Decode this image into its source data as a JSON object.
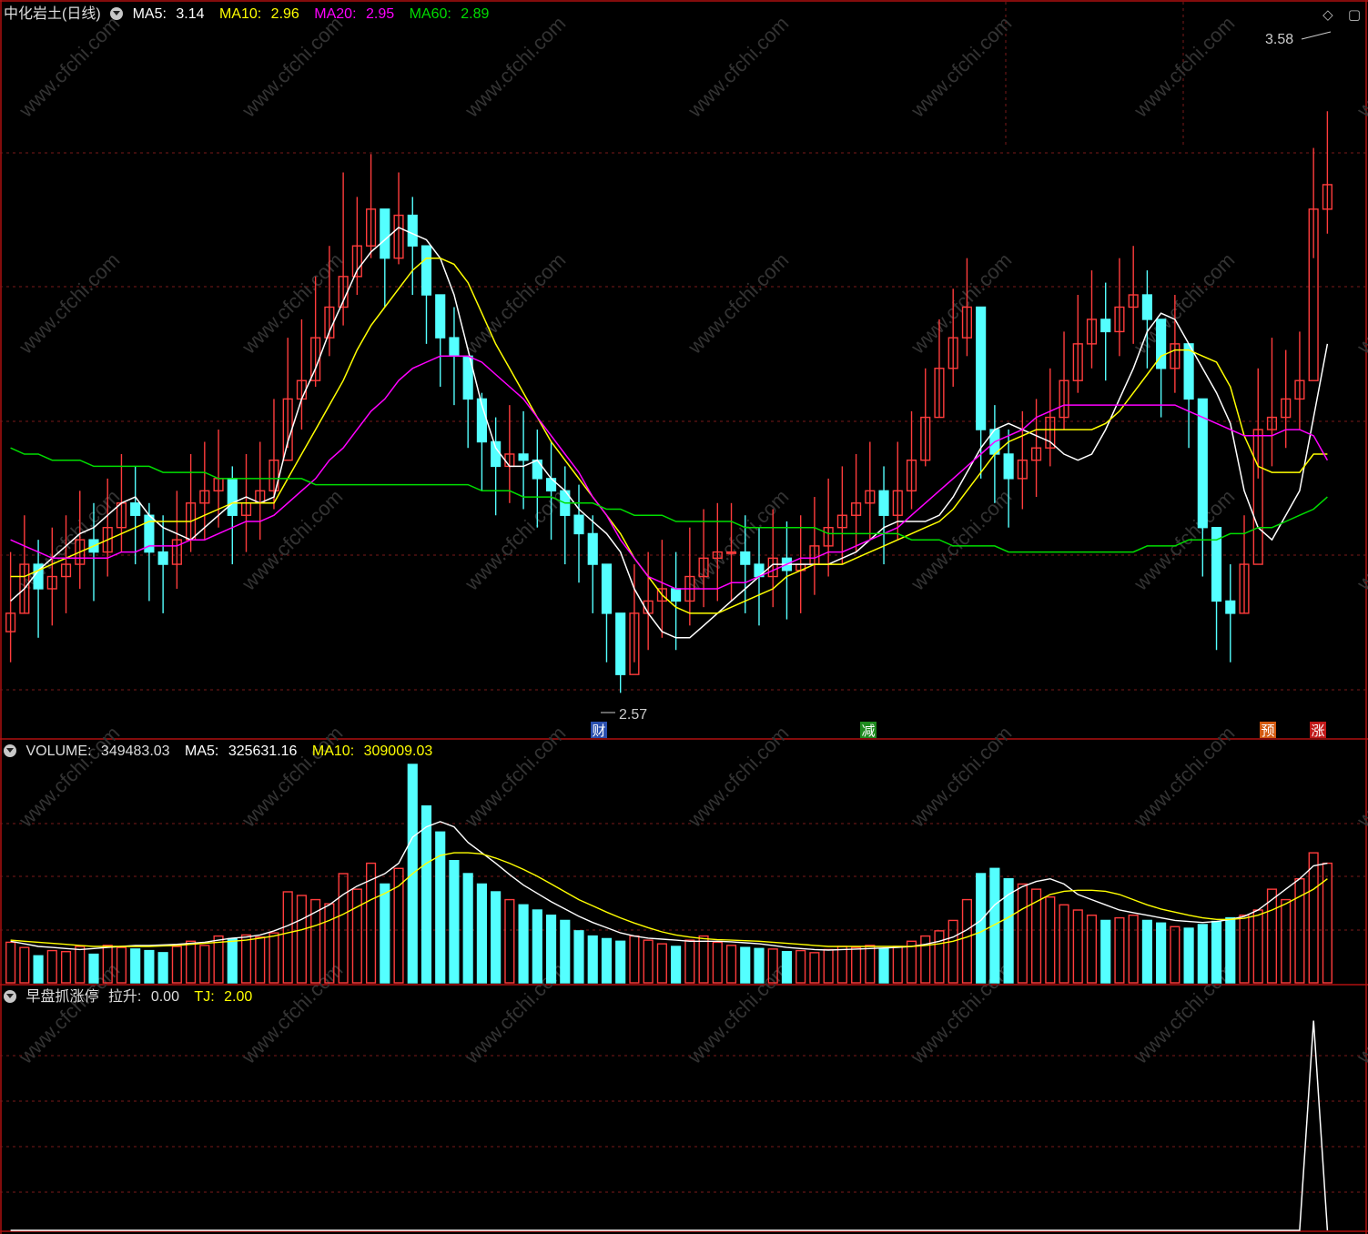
{
  "panel_price": {
    "stock_name": "中化岩土(日线)",
    "ma5_label": "MA5:",
    "ma5_value": "3.14",
    "ma10_label": "MA10:",
    "ma10_value": "2.96",
    "ma20_label": "MA20:",
    "ma20_value": "2.95",
    "ma60_label": "MA60:",
    "ma60_value": "2.89",
    "high_marker": "3.58",
    "low_marker": "2.57",
    "event_labels": [
      "财",
      "减",
      "预",
      "涨"
    ]
  },
  "panel_volume": {
    "volume_label": "VOLUME:",
    "volume_value": "349483.03",
    "ma5_label": "MA5:",
    "ma5_value": "325631.16",
    "ma10_label": "MA10:",
    "ma10_value": "309009.03"
  },
  "panel_indicator": {
    "name": "早盘抓涨停",
    "lift_label": "拉升:",
    "lift_value": "0.00",
    "tj_label": "TJ:",
    "tj_value": "2.00"
  },
  "icons": [
    "diamond-icon",
    "window-icon",
    "dropdown-icon"
  ],
  "watermark": "www.cfchi.com",
  "colors": {
    "up": "#ff3c3c",
    "down": "#54ffff",
    "ma5": "#ffffff",
    "ma10": "#ffff00",
    "ma20": "#ff00ff",
    "ma60": "#00dd00",
    "grid": "#7a1a1a",
    "border": "#b01010"
  },
  "chart_data": [
    {
      "type": "candlestick",
      "title": "中化岩土(日线)",
      "ylim": [
        2.52,
        3.66
      ],
      "series": [
        {
          "name": "MA5",
          "values": [
            2.72,
            2.74,
            2.77,
            2.79,
            2.81,
            2.83,
            2.84,
            2.86,
            2.88,
            2.89,
            2.86,
            2.84,
            2.83,
            2.82,
            2.84,
            2.86,
            2.88,
            2.89,
            2.88,
            2.89,
            2.98,
            3.05,
            3.1,
            3.16,
            3.21,
            3.26,
            3.29,
            3.31,
            3.33,
            3.32,
            3.31,
            3.28,
            3.22,
            3.13,
            3.04,
            2.97,
            2.94,
            2.94,
            2.95,
            2.92,
            2.9,
            2.87,
            2.85,
            2.83,
            2.8,
            2.74,
            2.7,
            2.67,
            2.66,
            2.66,
            2.68,
            2.7,
            2.72,
            2.74,
            2.76,
            2.78,
            2.78,
            2.78,
            2.78,
            2.78,
            2.79,
            2.8,
            2.82,
            2.84,
            2.85,
            2.85,
            2.85,
            2.86,
            2.89,
            2.93,
            2.97,
            3.0,
            3.01,
            3.0,
            2.99,
            2.98,
            2.96,
            2.95,
            2.96,
            3.0,
            3.05,
            3.1,
            3.16,
            3.19,
            3.18,
            3.14,
            3.1,
            3.06,
            3.01,
            2.9,
            2.84,
            2.82,
            2.86,
            2.9,
            3.02,
            3.14
          ]
        },
        {
          "name": "MA10",
          "values": [
            2.76,
            2.76,
            2.77,
            2.78,
            2.79,
            2.8,
            2.81,
            2.82,
            2.83,
            2.84,
            2.85,
            2.85,
            2.85,
            2.85,
            2.86,
            2.87,
            2.88,
            2.88,
            2.88,
            2.88,
            2.92,
            2.96,
            3.0,
            3.04,
            3.08,
            3.13,
            3.17,
            3.2,
            3.23,
            3.26,
            3.28,
            3.28,
            3.27,
            3.24,
            3.19,
            3.14,
            3.1,
            3.06,
            3.02,
            2.98,
            2.95,
            2.92,
            2.89,
            2.86,
            2.83,
            2.79,
            2.76,
            2.73,
            2.71,
            2.7,
            2.7,
            2.7,
            2.71,
            2.72,
            2.73,
            2.74,
            2.76,
            2.77,
            2.78,
            2.78,
            2.78,
            2.79,
            2.8,
            2.81,
            2.82,
            2.83,
            2.84,
            2.85,
            2.87,
            2.9,
            2.93,
            2.96,
            2.98,
            2.99,
            3.0,
            3.0,
            3.0,
            3.0,
            3.0,
            3.01,
            3.03,
            3.06,
            3.09,
            3.12,
            3.13,
            3.13,
            3.12,
            3.11,
            3.07,
            2.99,
            2.94,
            2.93,
            2.93,
            2.93,
            2.96,
            2.96
          ]
        },
        {
          "name": "MA20",
          "values": [
            2.82,
            2.81,
            2.8,
            2.79,
            2.79,
            2.79,
            2.79,
            2.79,
            2.8,
            2.8,
            2.81,
            2.81,
            2.81,
            2.82,
            2.82,
            2.83,
            2.84,
            2.85,
            2.85,
            2.86,
            2.88,
            2.9,
            2.92,
            2.95,
            2.97,
            3.0,
            3.03,
            3.05,
            3.08,
            3.1,
            3.11,
            3.12,
            3.12,
            3.12,
            3.11,
            3.09,
            3.07,
            3.05,
            3.02,
            2.99,
            2.96,
            2.93,
            2.89,
            2.86,
            2.82,
            2.79,
            2.76,
            2.75,
            2.74,
            2.74,
            2.74,
            2.74,
            2.75,
            2.75,
            2.76,
            2.77,
            2.78,
            2.79,
            2.79,
            2.8,
            2.8,
            2.81,
            2.82,
            2.83,
            2.84,
            2.86,
            2.88,
            2.9,
            2.92,
            2.94,
            2.96,
            2.98,
            2.99,
            3.0,
            3.02,
            3.03,
            3.04,
            3.04,
            3.04,
            3.04,
            3.04,
            3.04,
            3.04,
            3.04,
            3.04,
            3.03,
            3.02,
            3.01,
            3.0,
            2.99,
            2.99,
            2.99,
            3.0,
            3.0,
            2.99,
            2.95
          ]
        },
        {
          "name": "MA60",
          "values": [
            2.97,
            2.96,
            2.96,
            2.95,
            2.95,
            2.95,
            2.94,
            2.94,
            2.94,
            2.94,
            2.94,
            2.93,
            2.93,
            2.93,
            2.93,
            2.92,
            2.92,
            2.92,
            2.92,
            2.92,
            2.92,
            2.92,
            2.91,
            2.91,
            2.91,
            2.91,
            2.91,
            2.91,
            2.91,
            2.91,
            2.91,
            2.91,
            2.91,
            2.91,
            2.9,
            2.9,
            2.9,
            2.89,
            2.89,
            2.89,
            2.88,
            2.88,
            2.88,
            2.87,
            2.87,
            2.86,
            2.86,
            2.86,
            2.85,
            2.85,
            2.85,
            2.85,
            2.85,
            2.84,
            2.84,
            2.84,
            2.84,
            2.84,
            2.84,
            2.83,
            2.83,
            2.83,
            2.83,
            2.83,
            2.83,
            2.82,
            2.82,
            2.82,
            2.81,
            2.81,
            2.81,
            2.81,
            2.8,
            2.8,
            2.8,
            2.8,
            2.8,
            2.8,
            2.8,
            2.8,
            2.8,
            2.8,
            2.81,
            2.81,
            2.81,
            2.82,
            2.82,
            2.82,
            2.83,
            2.83,
            2.84,
            2.84,
            2.85,
            2.86,
            2.87,
            2.89
          ]
        }
      ],
      "candles_close": [
        2.7,
        2.78,
        2.74,
        2.76,
        2.78,
        2.82,
        2.8,
        2.84,
        2.88,
        2.86,
        2.8,
        2.78,
        2.82,
        2.88,
        2.9,
        2.92,
        2.86,
        2.88,
        2.9,
        2.95,
        3.05,
        3.08,
        3.15,
        3.2,
        3.25,
        3.3,
        3.36,
        3.28,
        3.35,
        3.3,
        3.22,
        3.15,
        3.12,
        3.05,
        2.98,
        2.94,
        2.96,
        2.95,
        2.92,
        2.9,
        2.86,
        2.83,
        2.78,
        2.7,
        2.6,
        2.7,
        2.72,
        2.74,
        2.72,
        2.76,
        2.79,
        2.8,
        2.8,
        2.78,
        2.76,
        2.79,
        2.77,
        2.78,
        2.81,
        2.84,
        2.86,
        2.88,
        2.9,
        2.86,
        2.9,
        2.95,
        3.02,
        3.1,
        3.15,
        3.2,
        3.0,
        2.96,
        2.92,
        2.95,
        2.97,
        3.02,
        3.08,
        3.14,
        3.18,
        3.16,
        3.2,
        3.22,
        3.18,
        3.1,
        3.14,
        3.05,
        2.84,
        2.72,
        2.7,
        2.78,
        3.0,
        3.02,
        3.05,
        3.08,
        3.36,
        3.4
      ],
      "candles_high": [
        2.8,
        2.86,
        2.82,
        2.84,
        2.86,
        2.9,
        2.88,
        2.92,
        2.96,
        2.94,
        2.88,
        2.86,
        2.9,
        2.96,
        2.98,
        3.0,
        2.94,
        2.96,
        2.98,
        3.05,
        3.15,
        3.18,
        3.25,
        3.3,
        3.42,
        3.38,
        3.45,
        3.36,
        3.42,
        3.38,
        3.3,
        3.22,
        3.2,
        3.12,
        3.06,
        3.02,
        3.04,
        3.03,
        3.0,
        2.98,
        2.94,
        2.91,
        2.86,
        2.78,
        2.7,
        2.78,
        2.8,
        2.82,
        2.8,
        2.84,
        2.87,
        2.88,
        2.88,
        2.86,
        2.84,
        2.87,
        2.85,
        2.86,
        2.89,
        2.92,
        2.94,
        2.96,
        2.98,
        2.94,
        2.98,
        3.03,
        3.1,
        3.18,
        3.23,
        3.28,
        3.08,
        3.04,
        3.0,
        3.03,
        3.05,
        3.1,
        3.16,
        3.22,
        3.26,
        3.24,
        3.28,
        3.3,
        3.26,
        3.18,
        3.22,
        3.13,
        2.92,
        2.8,
        2.78,
        2.86,
        3.1,
        3.15,
        3.13,
        3.16,
        3.46,
        3.52
      ],
      "candles_low": [
        2.62,
        2.7,
        2.66,
        2.68,
        2.7,
        2.74,
        2.72,
        2.76,
        2.8,
        2.78,
        2.72,
        2.7,
        2.74,
        2.8,
        2.82,
        2.84,
        2.78,
        2.8,
        2.82,
        2.87,
        2.97,
        3.0,
        3.07,
        3.12,
        3.17,
        3.22,
        3.28,
        3.2,
        3.27,
        3.22,
        3.14,
        3.07,
        3.04,
        2.97,
        2.9,
        2.86,
        2.88,
        2.87,
        2.84,
        2.82,
        2.78,
        2.75,
        2.7,
        2.62,
        2.57,
        2.62,
        2.64,
        2.66,
        2.64,
        2.68,
        2.71,
        2.72,
        2.72,
        2.7,
        2.68,
        2.71,
        2.69,
        2.7,
        2.73,
        2.76,
        2.78,
        2.8,
        2.82,
        2.78,
        2.82,
        2.87,
        2.94,
        3.02,
        3.07,
        3.12,
        2.92,
        2.88,
        2.84,
        2.87,
        2.89,
        2.94,
        3.0,
        3.06,
        3.1,
        3.08,
        3.12,
        3.14,
        3.1,
        3.02,
        3.06,
        2.97,
        2.76,
        2.64,
        2.62,
        2.7,
        2.92,
        2.94,
        2.97,
        3.0,
        3.28,
        3.32
      ],
      "annotations": [
        {
          "label": "3.58",
          "position": "top-right"
        },
        {
          "label": "2.57",
          "position": "low"
        }
      ]
    },
    {
      "type": "bar",
      "title": "VOLUME",
      "ylim": [
        0,
        420000
      ],
      "values": [
        78,
        68,
        52,
        62,
        60,
        70,
        55,
        72,
        68,
        65,
        62,
        58,
        70,
        80,
        72,
        90,
        85,
        92,
        88,
        96,
        175,
        168,
        160,
        152,
        210,
        180,
        230,
        190,
        220,
        420,
        340,
        290,
        235,
        210,
        190,
        175,
        160,
        150,
        140,
        130,
        120,
        100,
        90,
        85,
        80,
        90,
        82,
        75,
        70,
        82,
        90,
        78,
        72,
        68,
        66,
        65,
        60,
        62,
        58,
        64,
        70,
        68,
        72,
        66,
        70,
        80,
        90,
        100,
        120,
        160,
        210,
        220,
        200,
        190,
        180,
        165,
        150,
        140,
        130,
        120,
        125,
        130,
        120,
        115,
        108,
        105,
        112,
        118,
        125,
        130,
        140,
        180,
        160,
        200,
        250,
        230
      ],
      "series": [
        {
          "name": "MA5",
          "values": [
            80,
            75,
            70,
            68,
            66,
            64,
            66,
            68,
            70,
            72,
            72,
            73,
            74,
            76,
            78,
            82,
            86,
            88,
            92,
            100,
            110,
            122,
            136,
            150,
            170,
            186,
            198,
            210,
            230,
            280,
            300,
            310,
            300,
            270,
            250,
            230,
            208,
            188,
            172,
            156,
            142,
            128,
            116,
            106,
            96,
            90,
            86,
            84,
            82,
            80,
            80,
            80,
            79,
            77,
            75,
            72,
            68,
            66,
            64,
            63,
            64,
            65,
            66,
            67,
            68,
            70,
            74,
            80,
            88,
            102,
            120,
            150,
            170,
            185,
            195,
            200,
            190,
            170,
            160,
            150,
            140,
            135,
            130,
            125,
            120,
            118,
            116,
            118,
            122,
            128,
            140,
            160,
            180,
            200,
            225,
            230
          ]
        },
        {
          "name": "MA10",
          "values": [
            82,
            80,
            78,
            76,
            74,
            72,
            70,
            70,
            70,
            70,
            70,
            71,
            72,
            74,
            76,
            78,
            80,
            82,
            86,
            90,
            96,
            102,
            110,
            120,
            132,
            146,
            160,
            172,
            186,
            210,
            230,
            245,
            250,
            250,
            248,
            240,
            230,
            218,
            205,
            190,
            175,
            160,
            148,
            136,
            125,
            115,
            106,
            98,
            92,
            88,
            85,
            83,
            82,
            81,
            80,
            78,
            76,
            74,
            72,
            70,
            70,
            70,
            70,
            70,
            70,
            70,
            72,
            75,
            80,
            88,
            98,
            112,
            126,
            142,
            156,
            170,
            176,
            178,
            178,
            176,
            170,
            160,
            150,
            142,
            136,
            130,
            125,
            122,
            122,
            124,
            130,
            140,
            152,
            166,
            180,
            200
          ]
        }
      ]
    },
    {
      "type": "line",
      "title": "早盘抓涨停",
      "ylim": [
        0,
        2.1
      ],
      "series": [
        {
          "name": "TJ",
          "values": [
            0,
            0,
            0,
            0,
            0,
            0,
            0,
            0,
            0,
            0,
            0,
            0,
            0,
            0,
            0,
            0,
            0,
            0,
            0,
            0,
            0,
            0,
            0,
            0,
            0,
            0,
            0,
            0,
            0,
            0,
            0,
            0,
            0,
            0,
            0,
            0,
            0,
            0,
            0,
            0,
            0,
            0,
            0,
            0,
            0,
            0,
            0,
            0,
            0,
            0,
            0,
            0,
            0,
            0,
            0,
            0,
            0,
            0,
            0,
            0,
            0,
            0,
            0,
            0,
            0,
            0,
            0,
            0,
            0,
            0,
            0,
            0,
            0,
            0,
            0,
            0,
            0,
            0,
            0,
            0,
            0,
            0,
            0,
            0,
            0,
            0,
            0,
            0,
            0,
            0,
            0,
            0,
            0,
            0,
            2,
            0
          ]
        }
      ]
    }
  ]
}
